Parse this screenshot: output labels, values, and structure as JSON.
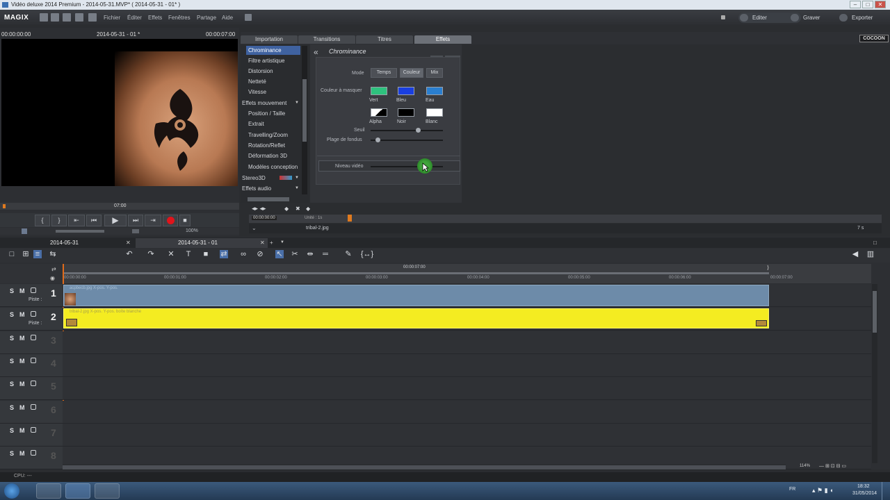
{
  "window": {
    "title": "Vidéo deluxe 2014 Premium - 2014-05-31.MVP* ( 2014-05-31 - 01* )"
  },
  "menu": {
    "logo": "MAGIX",
    "items": [
      "Fichier",
      "Éditer",
      "Effets",
      "Fenêtres",
      "Partage",
      "Aide"
    ],
    "modes": [
      "Editer",
      "Graver",
      "Exporter"
    ]
  },
  "preview": {
    "time_left": "00:00:00:00",
    "title": "2014-05-31 - 01 *",
    "time_right": "00:00:07:00",
    "scrub_time": "07:00",
    "zoom": "100%"
  },
  "tabs": [
    {
      "label": "Importation",
      "active": false
    },
    {
      "label": "Transitions",
      "active": false
    },
    {
      "label": "Titres",
      "active": false
    },
    {
      "label": "Effets",
      "active": true
    }
  ],
  "brand_badge": "COCOON",
  "categories": [
    {
      "label": "Chrominance",
      "selected": true,
      "header": false
    },
    {
      "label": "Filtre artistique",
      "selected": false,
      "header": false
    },
    {
      "label": "Distorsion",
      "selected": false,
      "header": false
    },
    {
      "label": "Netteté",
      "selected": false,
      "header": false
    },
    {
      "label": "Vitesse",
      "selected": false,
      "header": false
    },
    {
      "label": "Effets mouvement",
      "selected": false,
      "header": true
    },
    {
      "label": "Position / Taille",
      "selected": false,
      "header": false
    },
    {
      "label": "Extrait",
      "selected": false,
      "header": false
    },
    {
      "label": "Travelling/Zoom",
      "selected": false,
      "header": false
    },
    {
      "label": "Rotation/Reflet",
      "selected": false,
      "header": false
    },
    {
      "label": "Déformation 3D",
      "selected": false,
      "header": false
    },
    {
      "label": "Modèles conception",
      "selected": false,
      "header": false
    },
    {
      "label": "Stereo3D",
      "selected": false,
      "header": true
    },
    {
      "label": "Effets audio",
      "selected": false,
      "header": true
    }
  ],
  "effect": {
    "title": "Chrominance",
    "mode_label": "Mode",
    "mode_buttons": [
      "Temps",
      "Couleur",
      "Mix"
    ],
    "mask_label": "Couleur à masquer",
    "swatches": [
      {
        "name": "Vert",
        "color": "#2ec27e"
      },
      {
        "name": "Bleu",
        "color": "#1a3fe0"
      },
      {
        "name": "Eau",
        "color": "#2a7fd0"
      },
      {
        "name": "Alpha",
        "color": "#ffffff"
      },
      {
        "name": "Noir",
        "color": "#000000"
      },
      {
        "name": "Blanc",
        "color": "#ffffff"
      }
    ],
    "seuil_label": "Seuil",
    "plage_label": "Plage de fondus",
    "niveau_label": "Niveau vidéo",
    "seuil_value": 0.65,
    "plage_value": 0.1,
    "niveau_value": 0.75
  },
  "effect_timeline": {
    "time": "00:00:00:00",
    "unit_label": "Unité : 1s",
    "file": "tribal-2.jpg",
    "zoom": "7 s"
  },
  "timeline": {
    "tab1": "2014-05-31",
    "tab2": "2014-05-31 - 01",
    "center_time": "00:00:07:00",
    "ticks": [
      "00:00:00:00",
      "00:00:01:00",
      "00:00:02:00",
      "00:00:03:00",
      "00:00:04:00",
      "00:00:05:00",
      "00:00:06:00",
      "00:00:07:00"
    ],
    "tracks": [
      {
        "n": "1",
        "label": "Piste :",
        "clip": "acpbecb.jpg   X-pos.   Y-pos."
      },
      {
        "n": "2",
        "label": "Piste :",
        "clip": "tribal-2.jpg   X-pos.   Y-pos. boîte blanche"
      },
      {
        "n": "3",
        "label": "",
        "clip": ""
      },
      {
        "n": "4",
        "label": "",
        "clip": ""
      },
      {
        "n": "5",
        "label": "",
        "clip": ""
      },
      {
        "n": "6",
        "label": "",
        "clip": ""
      },
      {
        "n": "7",
        "label": "",
        "clip": ""
      },
      {
        "n": "8",
        "label": "",
        "clip": ""
      }
    ],
    "zoom": "114%"
  },
  "status": {
    "cpu": "CPU: ---"
  },
  "taskbar": {
    "lang": "FR",
    "time": "18:32",
    "date": "31/05/2014"
  }
}
